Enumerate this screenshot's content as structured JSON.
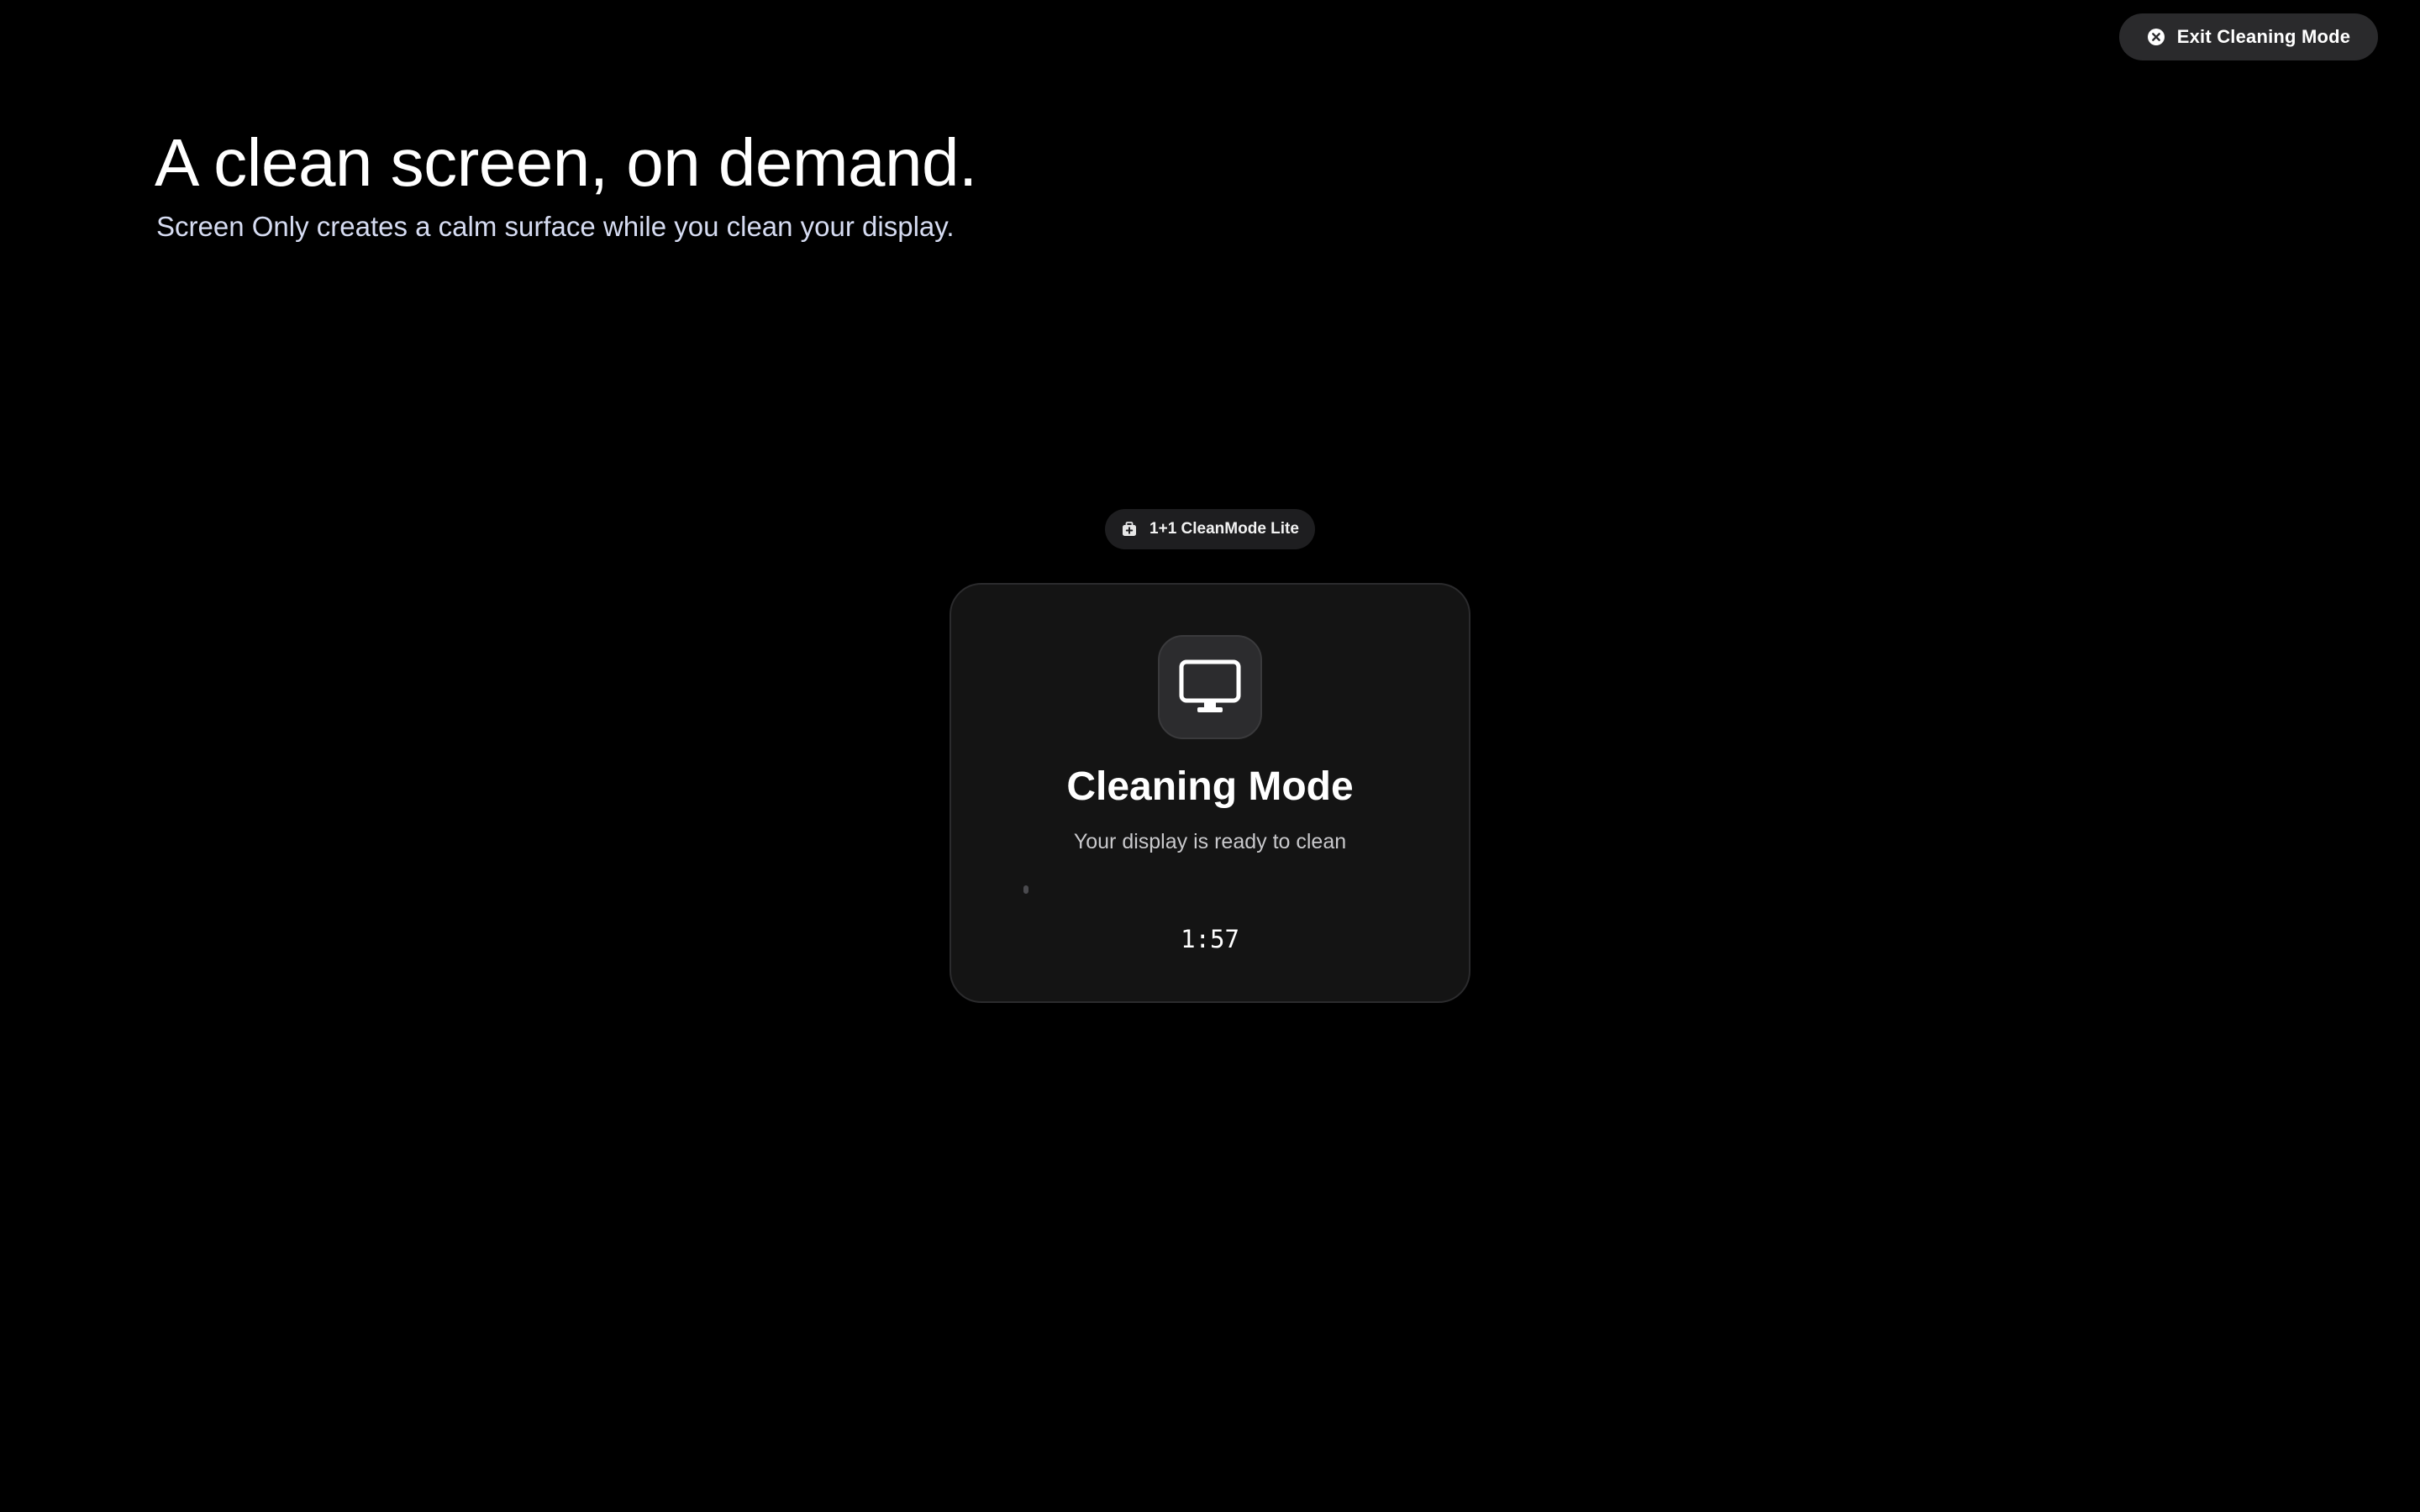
{
  "window": {
    "exit_button": {
      "label": "Exit Cleaning Mode",
      "icon": "close-circle-icon"
    }
  },
  "hero": {
    "title": "A clean screen, on demand.",
    "subtitle": "Screen Only creates a calm surface while you clean your display."
  },
  "badge": {
    "label": "1+1 CleanMode Lite",
    "icon": "briefcase-plus-icon"
  },
  "card": {
    "icon": "desktop-monitor-icon",
    "title": "Cleaning Mode",
    "subtitle": "Your display is ready to clean",
    "progress": 0.01,
    "timer": "1:57"
  },
  "colors": {
    "background": "#000000",
    "card_background": "#141414",
    "button_background": "#2a2a2c",
    "subtitle_text": "#d6dcf2"
  }
}
